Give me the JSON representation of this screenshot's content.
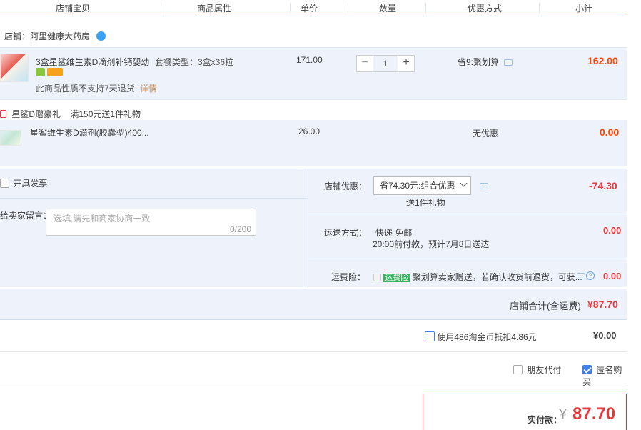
{
  "header": {
    "col_shop_item": "店铺宝贝",
    "col_attr": "商品属性",
    "col_price": "单价",
    "col_qty": "数量",
    "col_discount": "优惠方式",
    "col_subtotal": "小计"
  },
  "shop": {
    "label": "店铺：阿里健康大药房"
  },
  "item1": {
    "title": "3盒星鲨维生素D滴剂补钙婴幼...",
    "attr": "套餐类型：3盒x36粒",
    "price": "171.00",
    "qty": "1",
    "discount": "省9:聚划算",
    "subtotal": "162.00",
    "notice": "此商品性质不支持7天退货",
    "detail_link": "详情",
    "minus": "−",
    "plus": "+"
  },
  "gift": {
    "tag": "星鲨D赠豪礼",
    "rule": "满150元送1件礼物"
  },
  "item2": {
    "title": "星鲨维生素D滴剂(胶囊型)400...",
    "price": "26.00",
    "discount": "无优惠",
    "subtotal": "0.00"
  },
  "invoice": {
    "label": "开具发票"
  },
  "message": {
    "label": "给卖家留言：",
    "placeholder": "选填,请先和商家协商一致",
    "counter": "0/200"
  },
  "shop_discount": {
    "label": "店铺优惠：",
    "selected": "省74.30元:组合优惠",
    "note": "送1件礼物",
    "amount": "-74.30"
  },
  "shipping": {
    "label": "运送方式：",
    "method": "快递 免邮",
    "eta": "20:00前付款，预计7月8日送达",
    "amount": "0.00"
  },
  "insurance": {
    "label": "运费险：",
    "tag": "运费险",
    "text": "聚划算卖家赠送，若确认收货前退货，可获...",
    "amount": "0.00"
  },
  "shop_total": {
    "label": "店铺合计(含运费)",
    "amount": "¥87.70"
  },
  "coins": {
    "label": "使用486淘金币抵扣4.86元",
    "amount": "¥0.00"
  },
  "options": {
    "friend_pay": "朋友代付",
    "anonymous": "匿名购买"
  },
  "payment": {
    "label": "实付款：",
    "currency": "¥",
    "amount": "87.70"
  },
  "colors": {
    "accent_red": "#ff4400",
    "highlight_bg": "#eef3fb",
    "blue": "#3d7fe6"
  }
}
